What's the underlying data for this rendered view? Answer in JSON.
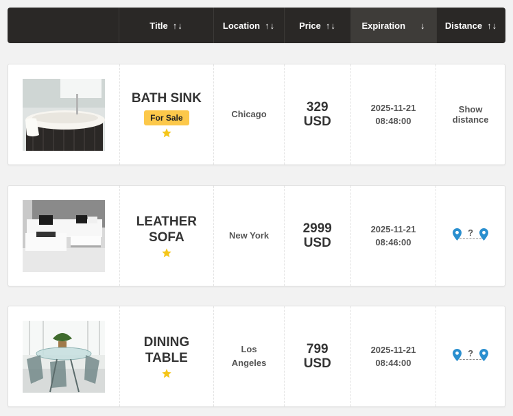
{
  "header": {
    "columns": [
      {
        "label": "",
        "arrows": ""
      },
      {
        "label": "Title",
        "arrows": "↑↓"
      },
      {
        "label": "Location",
        "arrows": "↑↓"
      },
      {
        "label": "Price",
        "arrows": "↑↓"
      },
      {
        "label": "Expiration",
        "arrows": "↓"
      },
      {
        "label": "Distance",
        "arrows": "↑↓"
      }
    ]
  },
  "listings": [
    {
      "title": "BATH SINK",
      "badge": "For Sale",
      "featured_icon": "star-icon",
      "location": "Chicago",
      "price_amount": "329",
      "price_currency": "USD",
      "exp_date": "2025-11-21",
      "exp_time": "08:48:00",
      "distance": "Show distance"
    },
    {
      "title": "LEATHER SOFA",
      "featured_icon": "star-icon",
      "location": "New York",
      "price_amount": "2999",
      "price_currency": "USD",
      "exp_date": "2025-11-21",
      "exp_time": "08:46:00",
      "distance": "?"
    },
    {
      "title": "DINING TABLE",
      "featured_icon": "star-icon",
      "location": "Los Angeles",
      "price_amount": "799",
      "price_currency": "USD",
      "exp_date": "2025-11-21",
      "exp_time": "08:44:00",
      "distance": "?"
    }
  ],
  "colors": {
    "header_bg": "#2a2826",
    "header_active_bg": "#3e3c39",
    "badge": "#fcc84a",
    "star": "#f5c518",
    "pin": "#2a8fcf"
  }
}
